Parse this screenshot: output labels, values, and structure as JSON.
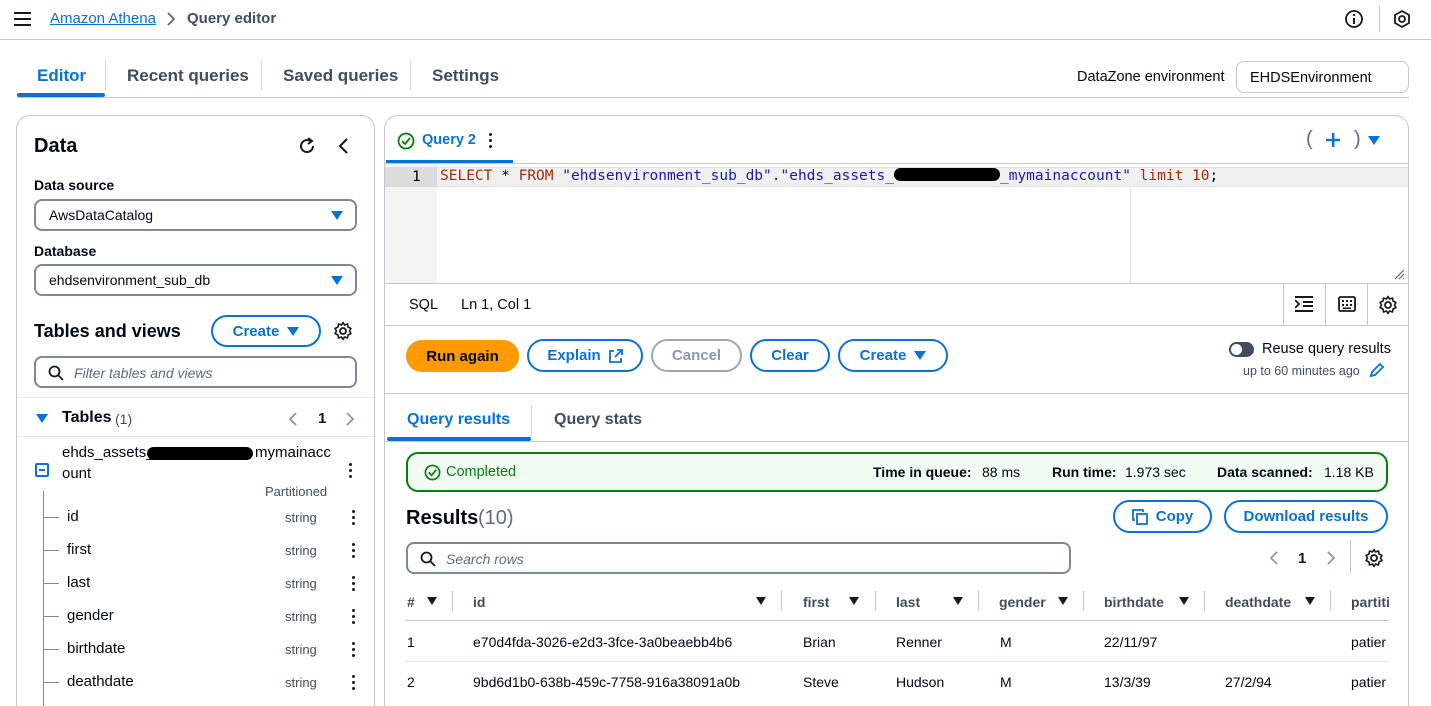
{
  "breadcrumb": {
    "service": "Amazon Athena",
    "current": "Query editor"
  },
  "tabs": [
    {
      "label": "Editor",
      "active": true
    },
    {
      "label": "Recent queries"
    },
    {
      "label": "Saved queries"
    },
    {
      "label": "Settings"
    }
  ],
  "datazone": {
    "label": "DataZone environment",
    "value": "EHDSEnvironment"
  },
  "data_panel": {
    "title": "Data",
    "data_source_label": "Data source",
    "data_source_value": "AwsDataCatalog",
    "database_label": "Database",
    "database_value": "ehdsenvironment_sub_db",
    "tables_views_title": "Tables and views",
    "create_label": "Create",
    "filter_placeholder": "Filter tables and views",
    "tables_label": "Tables",
    "tables_count": "(1)",
    "page": "1",
    "table_name_part1": "ehds_assets_",
    "table_name_part2": "mymainacc",
    "table_name_part3": "ount",
    "partitioned": "Partitioned",
    "columns": [
      {
        "name": "id",
        "type": "string"
      },
      {
        "name": "first",
        "type": "string"
      },
      {
        "name": "last",
        "type": "string"
      },
      {
        "name": "gender",
        "type": "string"
      },
      {
        "name": "birthdate",
        "type": "string"
      },
      {
        "name": "deathdate",
        "type": "string"
      }
    ]
  },
  "editor": {
    "query_tab": "Query 2",
    "line_number": "1",
    "sql_kw1": "SELECT",
    "sql_star": " * ",
    "sql_kw2": "FROM",
    "sql_str1": " \"ehdsenvironment_sub_db\".\"ehds_assets_",
    "sql_str2": "_mymainaccount\"",
    "sql_kw3": " limit ",
    "sql_num": "10",
    "sql_end": ";",
    "lang": "SQL",
    "cursor": "Ln 1, Col 1"
  },
  "actions": {
    "run_again": "Run again",
    "explain": "Explain",
    "cancel": "Cancel",
    "clear": "Clear",
    "create": "Create",
    "reuse_label": "Reuse query results",
    "reuse_sub": "up to 60 minutes ago"
  },
  "result_tabs": [
    {
      "label": "Query results",
      "active": true
    },
    {
      "label": "Query stats"
    }
  ],
  "status": {
    "state": "Completed",
    "queue_label": "Time in queue:",
    "queue_value": "88 ms",
    "run_label": "Run time:",
    "run_value": "1.973 sec",
    "scanned_label": "Data scanned:",
    "scanned_value": "1.18 KB"
  },
  "results": {
    "title": "Results",
    "count": "(10)",
    "copy": "Copy",
    "download": "Download results",
    "search_placeholder": "Search rows",
    "page": "1",
    "headers": [
      "#",
      "id",
      "first",
      "last",
      "gender",
      "birthdate",
      "deathdate",
      "partiti"
    ],
    "rows": [
      [
        "1",
        "e70d4fda-3026-e2d3-3fce-3a0beaebb4b6",
        "Brian",
        "Renner",
        "M",
        "22/11/97",
        "",
        "patier"
      ],
      [
        "2",
        "9bd6d1b0-638b-459c-7758-916a38091a0b",
        "Steve",
        "Hudson",
        "M",
        "13/3/39",
        "27/2/94",
        "patier"
      ]
    ]
  },
  "colors": {
    "accent": "#0972d3",
    "primary_button": "#ff9900",
    "success": "#037f0c"
  }
}
